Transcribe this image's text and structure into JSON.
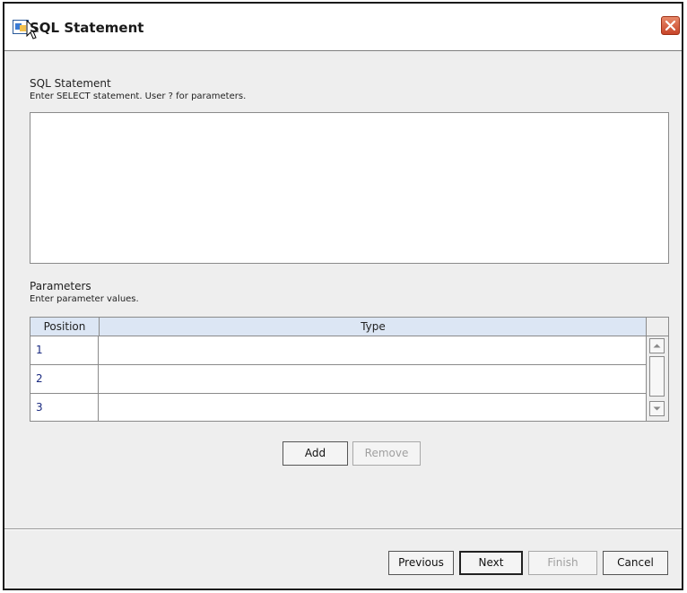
{
  "window": {
    "title": "SQL Statement"
  },
  "sql_section": {
    "title": "SQL Statement",
    "hint": "Enter SELECT statement.  User ? for parameters.",
    "value": ""
  },
  "params_section": {
    "title": "Parameters",
    "hint": "Enter parameter values.",
    "columns": [
      "Position",
      "Type"
    ],
    "rows": [
      {
        "position": "1",
        "type": ""
      },
      {
        "position": "2",
        "type": ""
      },
      {
        "position": "3",
        "type": ""
      }
    ]
  },
  "param_buttons": {
    "add": "Add",
    "remove": "Remove"
  },
  "nav_buttons": {
    "previous": "Previous",
    "next": "Next",
    "finish": "Finish",
    "cancel": "Cancel"
  },
  "icons": {
    "app": "app-icon",
    "close": "close-icon",
    "scroll_up": "scroll-up-icon",
    "scroll_down": "scroll-down-icon"
  },
  "colors": {
    "header_bg": "#dce6f4",
    "close_btn": "#c8452a",
    "position_text": "#1a2a80"
  }
}
